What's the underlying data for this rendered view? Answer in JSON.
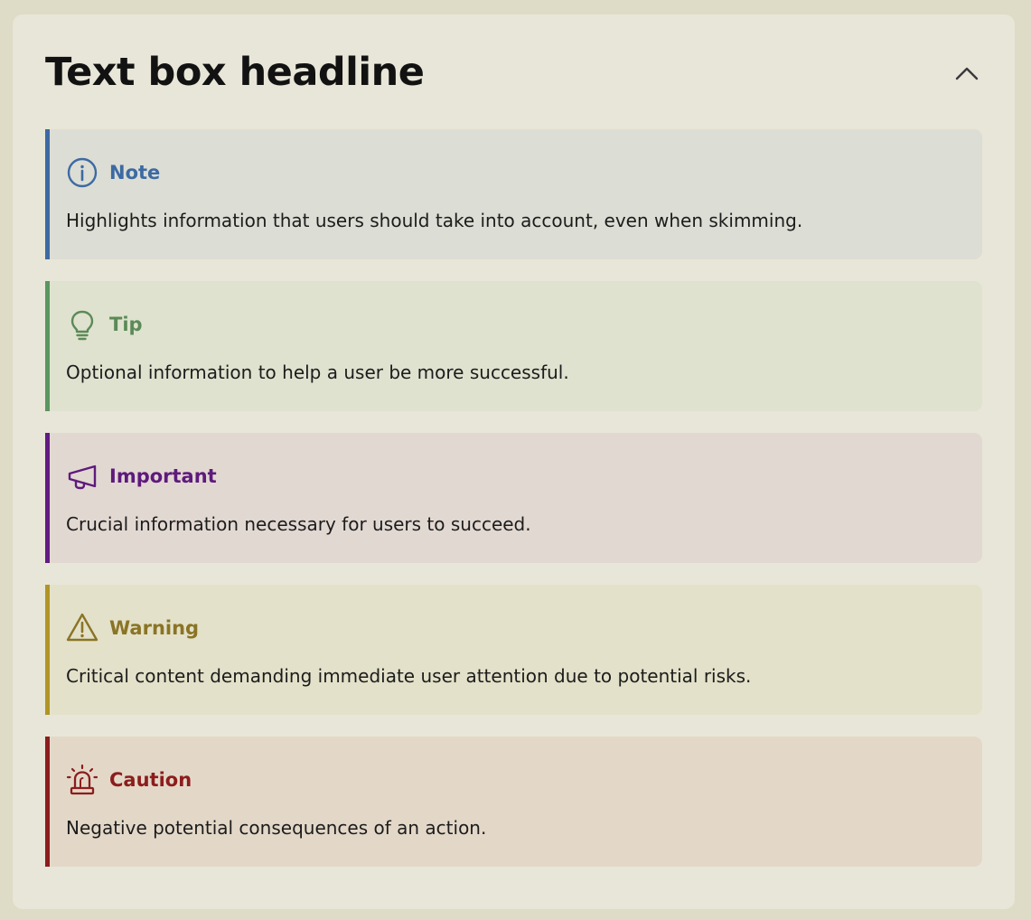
{
  "panel": {
    "title": "Text box headline"
  },
  "callouts": [
    {
      "id": "note",
      "title": "Note",
      "text": "Highlights information that users should take into account, even when skimming.",
      "icon": "info-icon",
      "accent": "#3d6aa3",
      "background": "#dcddd4"
    },
    {
      "id": "tip",
      "title": "Tip",
      "text": "Optional information to help a user be more successful.",
      "icon": "lightbulb-icon",
      "accent": "#5b9560",
      "background": "#dfe2cf"
    },
    {
      "id": "important",
      "title": "Important",
      "text": "Crucial information necessary for users to succeed.",
      "icon": "megaphone-icon",
      "accent": "#621b82",
      "background": "#e2d8d2"
    },
    {
      "id": "warning",
      "title": "Warning",
      "text": "Critical content demanding immediate user attention due to potential risks.",
      "icon": "warning-triangle-icon",
      "accent": "#b09526",
      "background": "#e3e1c9"
    },
    {
      "id": "caution",
      "title": "Caution",
      "text": "Negative potential consequences of an action.",
      "icon": "siren-icon",
      "accent": "#8c1d1d",
      "background": "#e3d8c8"
    }
  ],
  "title_colors": {
    "note": "#3d6aa3",
    "tip": "#5b8a57",
    "important": "#5e1a7c",
    "warning": "#8a7425",
    "caution": "#8c1d1d"
  }
}
